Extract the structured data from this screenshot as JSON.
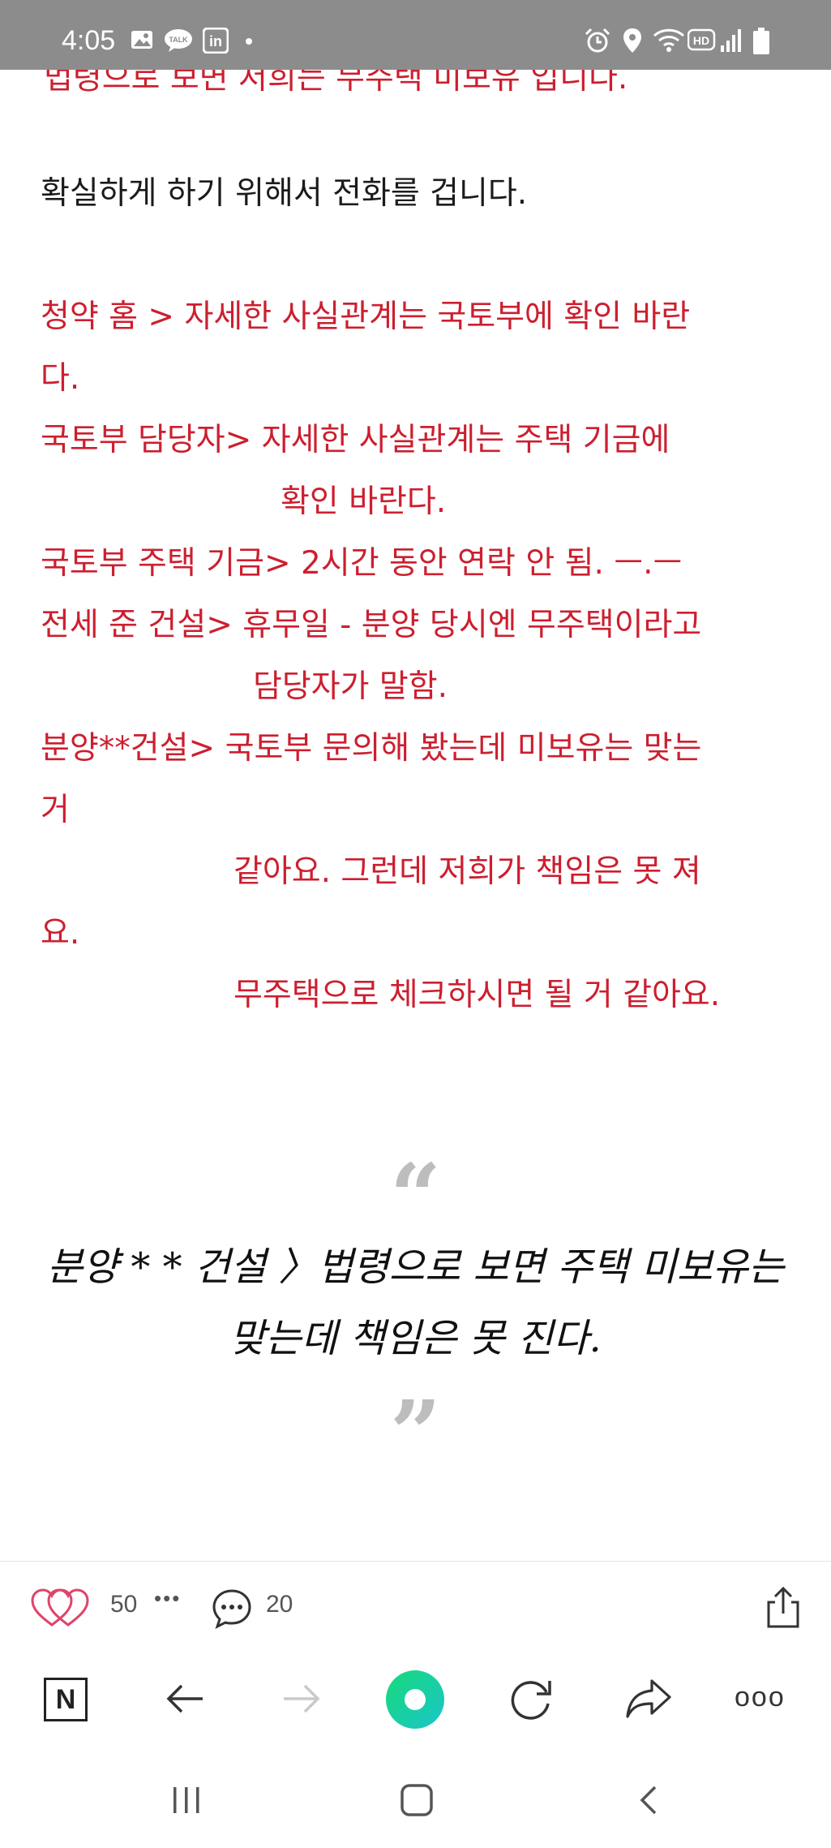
{
  "status_bar": {
    "time": "4:05",
    "left_icons": [
      "gallery-icon",
      "kakaotalk-icon",
      "linkedin-icon",
      "dot-icon"
    ],
    "right_icons": [
      "alarm-icon",
      "location-icon",
      "wifi-icon",
      "hd-icon",
      "signal-icon",
      "battery-icon"
    ]
  },
  "article": {
    "cutoff_line": "법령으로 보면 저희는 무주택 미보유 입니다.",
    "intro": "확실하게 하기 위해서 전화를 겁니다.",
    "lines": [
      "청약 홈 > 자세한 사실관계는 국토부에 확인 바란",
      "다.",
      "국토부 담당자> 자세한 사실관계는 주택 기금에",
      "확인 바란다.",
      "국토부 주택 기금> 2시간 동안 연락 안 됨. ㅡ.ㅡ",
      "전세 준 건설> 휴무일 - 분양 당시엔 무주택이라고",
      "담당자가 말함.",
      "분양**건설> 국토부 문의해 봤는데 미보유는 맞는",
      "거",
      "같아요. 그런데 저희가 책임은 못 져",
      "요.",
      "무주택으로 체크하시면 될 거 같아요."
    ],
    "quote": {
      "open_mark": "“",
      "line1": "분양 * * 건설 〉법령으로 보면 주택 미보유는",
      "line2": "맞는데 책임은 못 진다.",
      "close_mark": "”"
    }
  },
  "action_bar": {
    "like_count": "50",
    "more_label": "•••",
    "comment_count": "20"
  },
  "browser_bar": {
    "naver_label": "N",
    "more_label": "ooo"
  },
  "colors": {
    "accent_red": "#cc1f2f",
    "status_bar": "#8c8c8c",
    "naver_green": "#03c75a"
  }
}
